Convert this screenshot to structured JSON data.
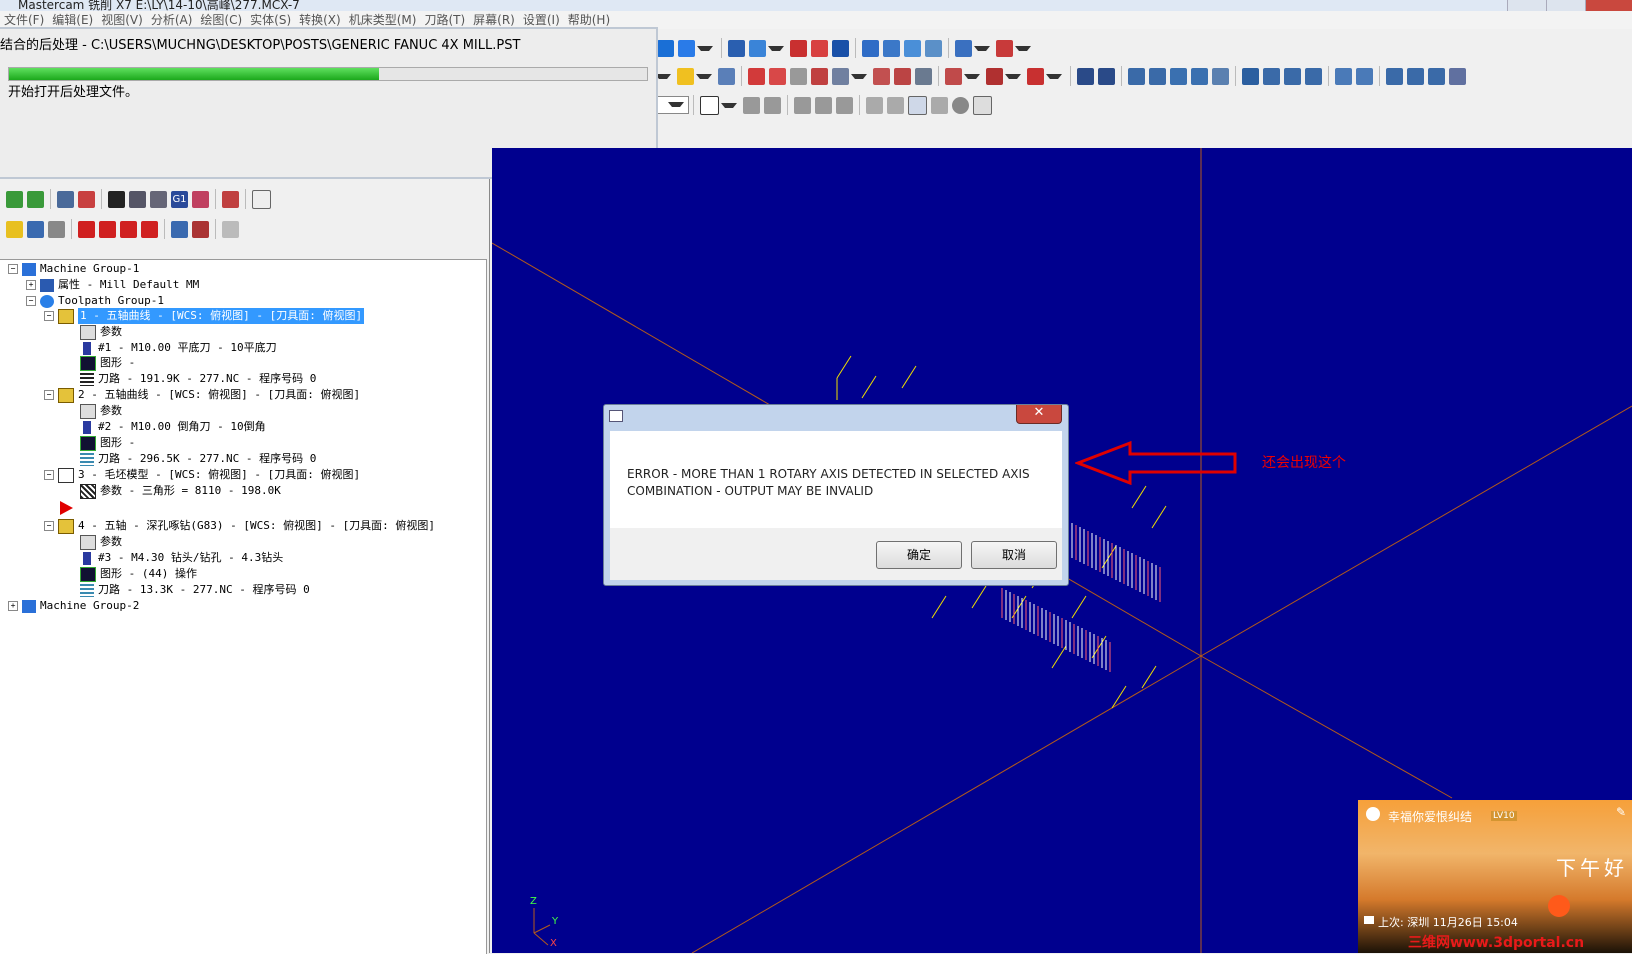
{
  "window": {
    "title": "Mastercam 铣削 X7  E:\\LY\\14-10\\高峰\\277.MCX-7"
  },
  "menu": [
    "文件(F)",
    "编辑(E)",
    "视图(V)",
    "分析(A)",
    "绘图(C)",
    "实体(S)",
    "转换(X)",
    "机床类型(M)",
    "刀路(T)",
    "屏幕(R)",
    "设置(I)",
    "帮助(H)"
  ],
  "progress_dialog": {
    "title": "结合的后处理 - C:\\USERS\\MUCHNG\\DESKTOP\\POSTS\\GENERIC FANUC 4X MILL.PST",
    "progress": 0.58,
    "status": "开始打开后处理文件。"
  },
  "toolpath_manager": {
    "tree": [
      {
        "label": "Machine Group-1",
        "level": 0,
        "icon": "machine-group-icon",
        "expander": "minus"
      },
      {
        "label": "属性 - Mill Default MM",
        "level": 1,
        "icon": "properties-icon",
        "expander": "plus"
      },
      {
        "label": "Toolpath Group-1",
        "level": 1,
        "icon": "toolpath-group-icon",
        "expander": "minus"
      },
      {
        "label": "1 - 五轴曲线 - [WCS: 俯视图] - [刀具面: 俯视图]",
        "level": 2,
        "icon": "operation-folder-icon",
        "expander": "minus",
        "selected": true
      },
      {
        "label": "参数",
        "level": 3,
        "icon": "parameters-icon"
      },
      {
        "label": "#1 - M10.00 平底刀 - 10平底刀",
        "level": 3,
        "icon": "tool-icon"
      },
      {
        "label": "图形 -",
        "level": 3,
        "icon": "geometry-icon"
      },
      {
        "label": "刀路 - 191.9K - 277.NC - 程序号码 0",
        "level": 3,
        "icon": "toolpath-icon"
      },
      {
        "label": "2 - 五轴曲线 - [WCS: 俯视图] - [刀具面: 俯视图]",
        "level": 2,
        "icon": "operation-folder-icon",
        "expander": "minus"
      },
      {
        "label": "参数",
        "level": 3,
        "icon": "parameters-icon"
      },
      {
        "label": "#2 - M10.00 倒角刀 - 10倒角",
        "level": 3,
        "icon": "tool-icon"
      },
      {
        "label": "图形 -",
        "level": 3,
        "icon": "geometry-icon"
      },
      {
        "label": "刀路 - 296.5K - 277.NC - 程序号码 0",
        "level": 3,
        "icon": "toolpath-icon"
      },
      {
        "label": "3 - 毛坯模型 - [WCS: 俯视图] - [刀具面: 俯视图]",
        "level": 2,
        "icon": "stock-model-icon",
        "expander": "minus"
      },
      {
        "label": "参数 - 三角形 =  8110 - 198.0K",
        "level": 3,
        "icon": "stock-params-icon"
      },
      {
        "label": "",
        "level": 2,
        "icon": "insert-arrow-icon"
      },
      {
        "label": "4 - 五轴 - 深孔啄钻(G83) - [WCS: 俯视图] - [刀具面: 俯视图]",
        "level": 2,
        "icon": "operation-folder-icon",
        "expander": "minus"
      },
      {
        "label": "参数",
        "level": 3,
        "icon": "parameters-icon"
      },
      {
        "label": "#3 - M4.30 钻头/钻孔 -  4.3钻头",
        "level": 3,
        "icon": "tool-icon"
      },
      {
        "label": "图形 - (44) 操作",
        "level": 3,
        "icon": "geometry-icon"
      },
      {
        "label": "刀路 - 13.3K - 277.NC - 程序号码 0",
        "level": 3,
        "icon": "toolpath-icon"
      },
      {
        "label": "Machine Group-2",
        "level": 0,
        "icon": "machine-group-icon",
        "expander": "plus"
      }
    ]
  },
  "error_dialog": {
    "message": "ERROR - MORE THAN 1 ROTARY AXIS DETECTED IN SELECTED AXIS COMBINATION - OUTPUT MAY BE INVALID",
    "ok_label": "确定",
    "cancel_label": "取消",
    "close_label": "✕"
  },
  "annotation": {
    "text": "还会出现这个",
    "color": "#e00000"
  },
  "viewport": {
    "background": "#00008e",
    "axis_color": "#b35a1a",
    "toolpath_color": "#f0e000",
    "axis_labels": [
      "Z",
      "Y",
      "X"
    ]
  },
  "chat_popup": {
    "name": "幸福你爱恨纠结",
    "badge": "LV10",
    "signature": "下午好",
    "last_seen": "上次: 深圳  11月26日 15:04",
    "watermark": "三维网www.3dportal.cn"
  }
}
